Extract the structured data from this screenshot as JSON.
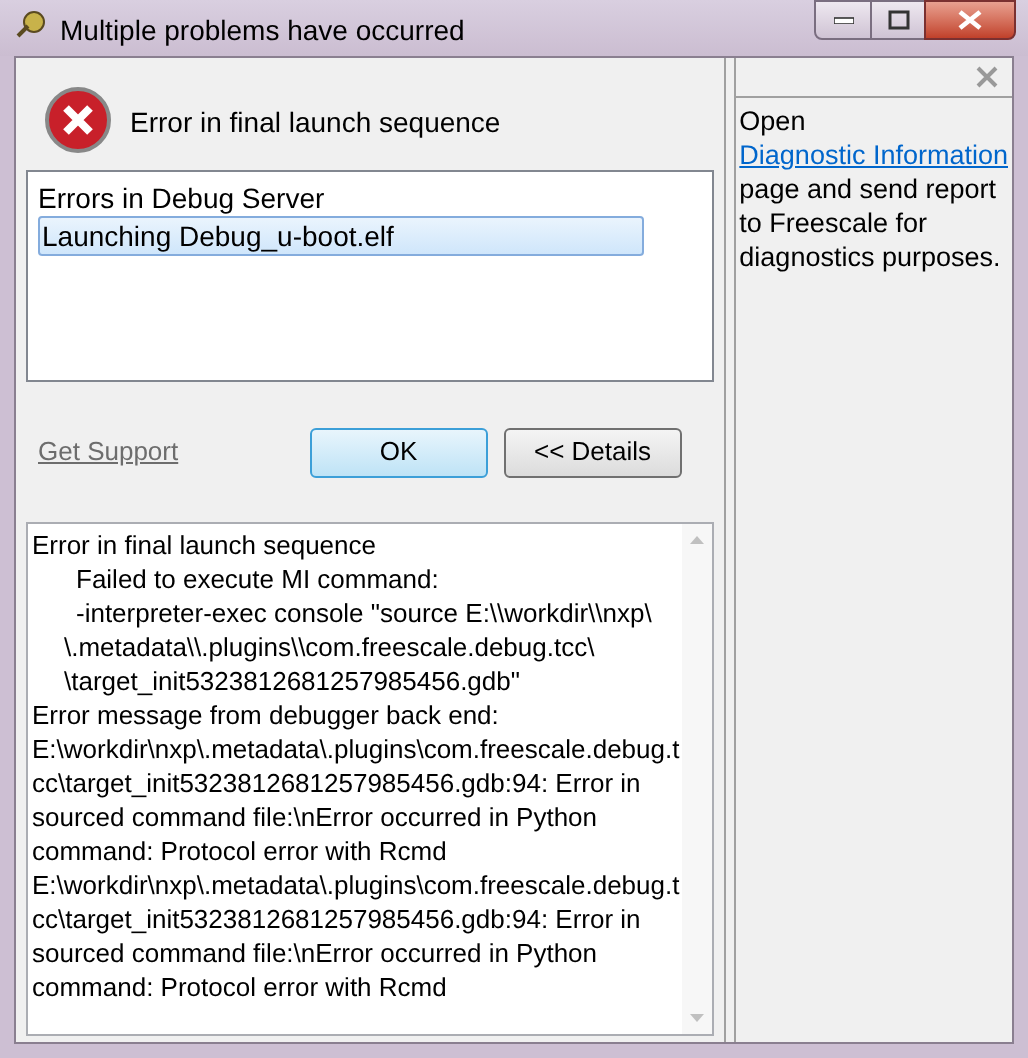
{
  "window": {
    "title": "Multiple problems have occurred"
  },
  "message": "Error in final launch sequence",
  "problems": {
    "heading": "Errors in Debug Server",
    "items": [
      {
        "label": "Launching Debug_u-boot.elf",
        "selected": true
      }
    ]
  },
  "support_link": "Get Support",
  "buttons": [
    {
      "label": "OK",
      "default": true
    },
    {
      "label": "<< Details",
      "default": false
    }
  ],
  "details": [
    {
      "kind": "line",
      "text": "Error in final launch sequence"
    },
    {
      "kind": "indented",
      "text": "Failed to execute MI command:"
    },
    {
      "kind": "indented",
      "text": "-interpreter-exec console \"source E:\\\\workdir\\\\nxp\\"
    },
    {
      "kind": "hanging",
      "text": "\\.metadata\\\\.plugins\\\\com.freescale.debug.tcc\\"
    },
    {
      "kind": "hanging",
      "text": "\\target_init5323812681257985456.gdb\""
    },
    {
      "kind": "line",
      "text": "Error message from debugger back end:"
    },
    {
      "kind": "line",
      "text": "E:\\workdir\\nxp\\.metadata\\.plugins\\com.freescale.debug.t"
    },
    {
      "kind": "line",
      "text": "cc\\target_init5323812681257985456.gdb:94: Error in"
    },
    {
      "kind": "line",
      "text": "sourced command file:\\nError occurred in Python"
    },
    {
      "kind": "line",
      "text": "command: Protocol error with Rcmd"
    },
    {
      "kind": "line",
      "text": "E:\\workdir\\nxp\\.metadata\\.plugins\\com.freescale.debug.t"
    },
    {
      "kind": "line",
      "text": "cc\\target_init5323812681257985456.gdb:94: Error in"
    },
    {
      "kind": "line",
      "text": "sourced command file:\\nError occurred in Python"
    },
    {
      "kind": "line",
      "text": "command: Protocol error with Rcmd"
    }
  ],
  "side_panel": {
    "before": "Open ",
    "link": "Diagnostic Information",
    "after": " page and send report to Freescale for diagnostics purposes."
  }
}
